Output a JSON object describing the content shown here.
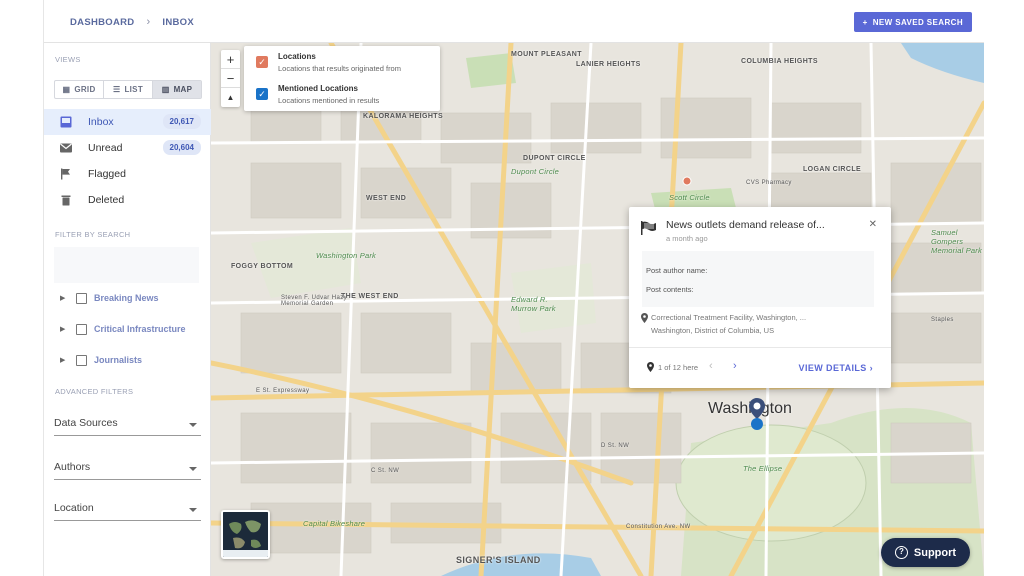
{
  "header": {
    "breadcrumb": [
      "DASHBOARD",
      "INBOX"
    ],
    "new_saved_search_label": "NEW SAVED SEARCH"
  },
  "sidebar": {
    "views_title": "VIEWS",
    "views": [
      {
        "label": "GRID",
        "icon": "grid-icon",
        "active": false
      },
      {
        "label": "LIST",
        "icon": "list-icon",
        "active": false
      },
      {
        "label": "MAP",
        "icon": "map-icon",
        "active": true
      }
    ],
    "folders": [
      {
        "label": "Inbox",
        "count": "20,617",
        "icon": "inbox-icon",
        "active": true
      },
      {
        "label": "Unread",
        "count": "20,604",
        "icon": "mail-icon",
        "active": false
      },
      {
        "label": "Flagged",
        "count": "",
        "icon": "flag-icon",
        "active": false
      },
      {
        "label": "Deleted",
        "count": "",
        "icon": "trash-icon",
        "active": false
      }
    ],
    "filter_title": "FILTER BY SEARCH",
    "search_groups": [
      "Breaking News",
      "Critical Infrastructure",
      "Journalists"
    ],
    "advanced_title": "ADVANCED FILTERS",
    "advanced_filters": [
      "Data Sources",
      "Authors",
      "Location"
    ]
  },
  "map": {
    "legend": [
      {
        "title": "Locations",
        "subtitle": "Locations that results originated from",
        "checked": true,
        "color": "#e07a5f"
      },
      {
        "title": "Mentioned Locations",
        "subtitle": "Locations mentioned in results",
        "checked": true,
        "color": "#1a73c8"
      }
    ],
    "labels": {
      "mount_pleasant": "MOUNT PLEASANT",
      "lanier_heights": "LANIER HEIGHTS",
      "columbia_heights": "COLUMBIA HEIGHTS",
      "kalorama_heights": "KALORAMA HEIGHTS",
      "dupont_circle": "DUPONT CIRCLE",
      "dupont_circle_g": "Dupont Circle",
      "scott_circle": "Scott Circle",
      "cvs": "CVS Pharmacy",
      "logan_circle": "LOGAN CIRCLE",
      "west_end": "WEST END",
      "foggy_bottom": "FOGGY BOTTOM",
      "washington_park": "Washington Park",
      "the_west_end": "THE WEST END",
      "edward_murrow": "Edward R. Murrow Park",
      "steven_dixon": "Steven F. Udvar Hazy Memorial Garden",
      "samuel_gompers": "Samuel Gompers Memorial Park",
      "staples": "Staples",
      "washington": "Washington",
      "the_ellipse": "The Ellipse",
      "capital_bikeshare": "Capital Bikeshare",
      "signers_island": "SIGNER'S ISLAND",
      "constitution_ave": "Constitution Ave. NW",
      "e_st": "E St. Expressway",
      "d_st": "D St. NW",
      "c_st": "C St. NW"
    },
    "zoom": {
      "in": "+",
      "out": "−",
      "compass": "▲"
    }
  },
  "popup": {
    "title": "News outlets demand release of...",
    "time": "a month ago",
    "post_author_label": "Post author name:",
    "post_contents_label": "Post contents:",
    "location_line1": "Correctional Treatment Facility, Washington, ...",
    "location_line2": "Washington, District of Columbia, US",
    "pager": "1 of 12 here",
    "view_details": "VIEW DETAILS",
    "close": "✕"
  },
  "support": {
    "label": "Support"
  }
}
